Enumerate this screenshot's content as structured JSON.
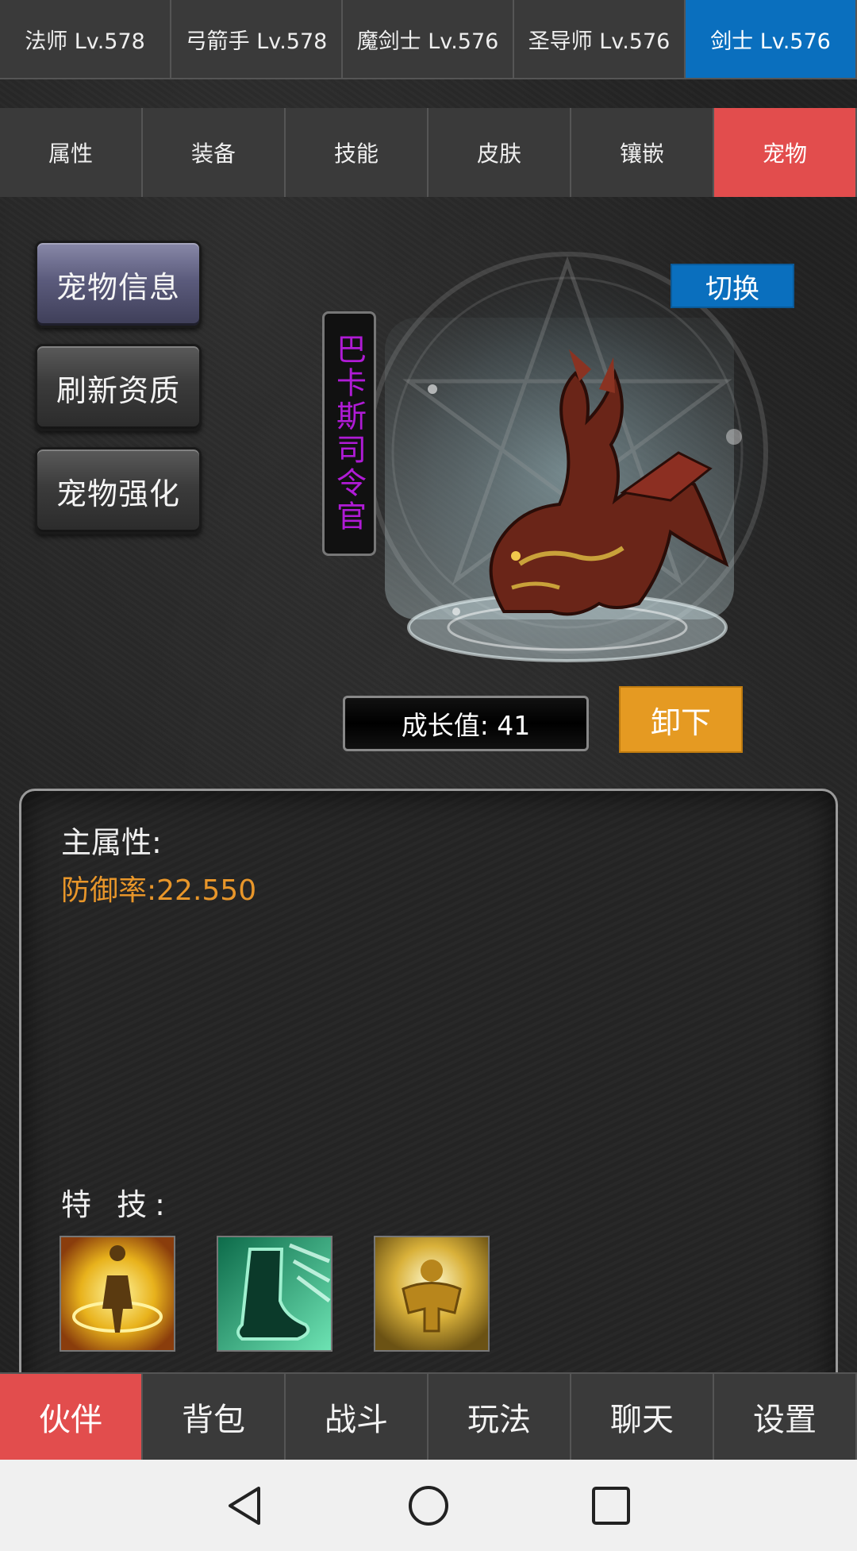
{
  "character_tabs": [
    {
      "label": "法师 Lv.578"
    },
    {
      "label": "弓箭手 Lv.578"
    },
    {
      "label": "魔剑士 Lv.576"
    },
    {
      "label": "圣导师 Lv.576"
    },
    {
      "label": "剑士 Lv.576"
    }
  ],
  "section_tabs": [
    {
      "label": "属性"
    },
    {
      "label": "装备"
    },
    {
      "label": "技能"
    },
    {
      "label": "皮肤"
    },
    {
      "label": "镶嵌"
    },
    {
      "label": "宠物"
    }
  ],
  "side_buttons": [
    {
      "label": "宠物信息"
    },
    {
      "label": "刷新资质"
    },
    {
      "label": "宠物强化"
    }
  ],
  "pet": {
    "name": "巴卡斯司令官",
    "switch_label": "切换",
    "growth_text": "成长值: 41",
    "unload_label": "卸下"
  },
  "info": {
    "main_attr_label": "主属性:",
    "attr_line": "防御率:22.550",
    "skills_label": "特 技:",
    "skill_icons": [
      "golden-aura-skill-icon",
      "green-boot-skill-icon",
      "golden-warrior-skill-icon"
    ]
  },
  "bottom_nav": [
    {
      "label": "伙伴"
    },
    {
      "label": "背包"
    },
    {
      "label": "战斗"
    },
    {
      "label": "玩法"
    },
    {
      "label": "聊天"
    },
    {
      "label": "设置"
    }
  ],
  "colors": {
    "active_blue": "#0a6fbe",
    "active_red": "#e24d4d",
    "orange": "#e59a22",
    "pet_name_purple": "#b01bd6",
    "attr_orange": "#e8962a"
  }
}
